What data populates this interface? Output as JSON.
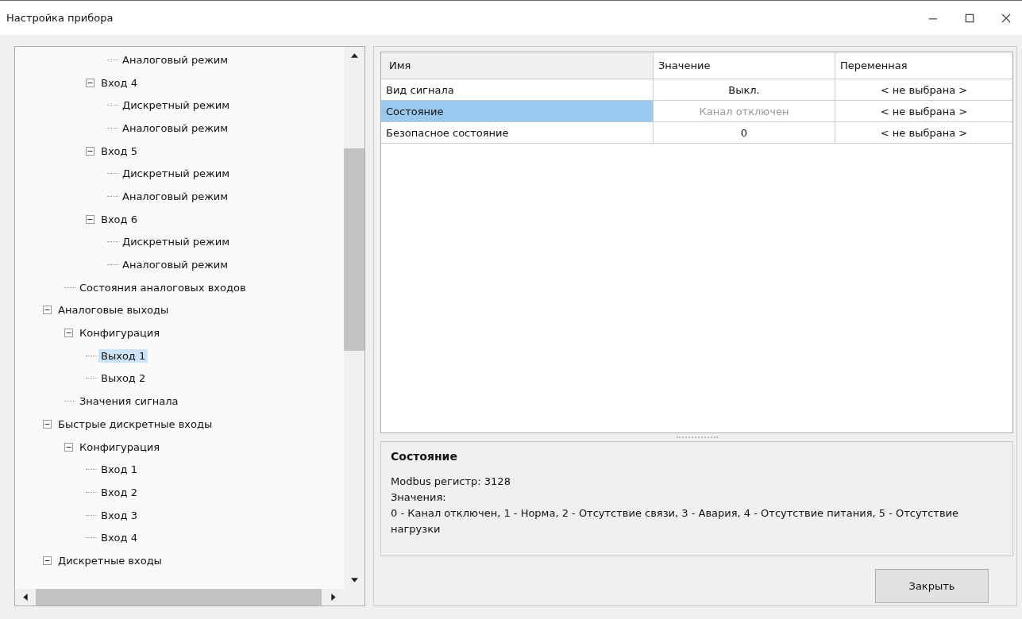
{
  "window": {
    "title": "Настройка прибора"
  },
  "tree": [
    {
      "children": [
        {
          "children": [
            {
              "children": [
                {
                  "children": [
                    {
                      "label": "Аналоговый режим",
                      "selected": false
                    }
                  ]
                },
                {
                  "label": "Вход 4",
                  "expanded": true,
                  "selected": false,
                  "children": [
                    {
                      "label": "Дискретный режим",
                      "selected": false
                    },
                    {
                      "label": "Аналоговый режим",
                      "selected": false
                    }
                  ]
                },
                {
                  "label": "Вход 5",
                  "expanded": true,
                  "selected": false,
                  "children": [
                    {
                      "label": "Дискретный режим",
                      "selected": false
                    },
                    {
                      "label": "Аналоговый режим",
                      "selected": false
                    }
                  ]
                },
                {
                  "label": "Вход 6",
                  "expanded": true,
                  "selected": false,
                  "children": [
                    {
                      "label": "Дискретный режим",
                      "selected": false
                    },
                    {
                      "label": "Аналоговый режим",
                      "selected": false
                    }
                  ]
                }
              ]
            },
            {
              "label": "Состояния аналоговых входов",
              "selected": false
            }
          ]
        },
        {
          "label": "Аналоговые выходы",
          "expanded": true,
          "selected": false,
          "children": [
            {
              "label": "Конфигурация",
              "expanded": true,
              "selected": false,
              "children": [
                {
                  "label": "Выход 1",
                  "selected": true
                },
                {
                  "label": "Выход 2",
                  "selected": false
                }
              ]
            },
            {
              "label": "Значения сигнала",
              "selected": false
            }
          ]
        },
        {
          "label": "Быстрые дискретные входы",
          "expanded": true,
          "selected": false,
          "children": [
            {
              "label": "Конфигурация",
              "expanded": true,
              "selected": false,
              "children": [
                {
                  "label": "Вход 1",
                  "selected": false
                },
                {
                  "label": "Вход 2",
                  "selected": false
                },
                {
                  "label": "Вход 3",
                  "selected": false
                },
                {
                  "label": "Вход 4",
                  "selected": false
                }
              ]
            }
          ]
        },
        {
          "label": "Дискретные входы",
          "expanded": true,
          "selected": false
        }
      ]
    }
  ],
  "table": {
    "columns": [
      "Имя",
      "Значение",
      "Переменная"
    ],
    "rows": [
      {
        "name": "Вид сигнала",
        "value": "Выкл.",
        "variable": "< не выбрана >",
        "selected": false,
        "disabled": false
      },
      {
        "name": "Состояние",
        "value": "Канал отключен",
        "variable": "< не выбрана >",
        "selected": true,
        "disabled": true
      },
      {
        "name": "Безопасное состояние",
        "value": "0",
        "variable": "< не выбрана >",
        "selected": false,
        "disabled": false
      }
    ]
  },
  "description": {
    "title": "Состояние",
    "lines": [
      "Modbus регистр: 3128",
      "Значения:",
      "0 - Канал отключен, 1 - Норма, 2 - Отсутствие связи, 3 - Авария, 4 - Отсутствие питания, 5 - Отсутствие нагрузки"
    ]
  },
  "buttons": [
    "Закрыть"
  ]
}
